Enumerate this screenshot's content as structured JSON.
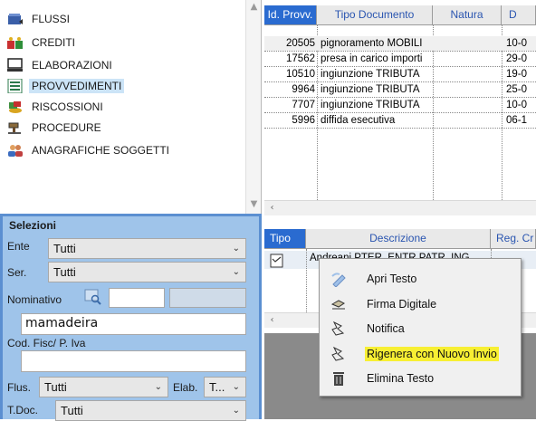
{
  "nav": {
    "items": [
      {
        "label": "FLUSSI",
        "icon": "folder-stack-icon"
      },
      {
        "label": "CREDITI",
        "icon": "money-bags-icon"
      },
      {
        "label": "ELABORAZIONI",
        "icon": "computer-icon"
      },
      {
        "label": "PROVVEDIMENTI",
        "icon": "document-form-icon",
        "selected": true
      },
      {
        "label": "RISCOSSIONI",
        "icon": "coins-icon"
      },
      {
        "label": "PROCEDURE",
        "icon": "gavel-icon"
      },
      {
        "label": "ANAGRAFICHE SOGGETTI",
        "icon": "users-icon"
      }
    ]
  },
  "selezioni": {
    "title": "Selezioni",
    "ente_label": "Ente",
    "ente_value": "Tutti",
    "ser_label": "Ser.",
    "ser_value": "Tutti",
    "nominativo_label": "Nominativo",
    "nominativo_value": "mamadeira",
    "codfisc_label": "Cod. Fisc/ P. Iva",
    "codfisc_value": "",
    "flus_label": "Flus.",
    "flus_value": "Tutti",
    "elab_label": "Elab.",
    "elab_value": "T...",
    "tdoc_label": "T.Doc.",
    "tdoc_value": "Tutti"
  },
  "grid_provv": {
    "columns": [
      "Id. Provv.",
      "Tipo Documento",
      "Natura",
      "D"
    ],
    "rows": [
      {
        "id": "20505",
        "tipo": "pignoramento MOBILI",
        "natura": "",
        "data": "10-0"
      },
      {
        "id": "17562",
        "tipo": "presa in carico importi",
        "natura": "",
        "data": "29-0"
      },
      {
        "id": "10510",
        "tipo": "ingiunzione TRIBUTA",
        "natura": "",
        "data": "19-0"
      },
      {
        "id": "9964",
        "tipo": "ingiunzione TRIBUTA",
        "natura": "",
        "data": "25-0"
      },
      {
        "id": "7707",
        "tipo": "ingiunzione TRIBUTA",
        "natura": "",
        "data": "10-0"
      },
      {
        "id": "5996",
        "tipo": "diffida esecutiva",
        "natura": "",
        "data": "06-1"
      }
    ]
  },
  "grid_doc": {
    "columns": [
      "Tipo",
      "Descrizione",
      "Reg. Cr"
    ],
    "rows": [
      {
        "descrizione": "Andreani PTER, ENTR PATR, ING"
      }
    ]
  },
  "context_menu": {
    "items": [
      {
        "label": "Apri Testo",
        "icon": "open-text-icon"
      },
      {
        "label": "Firma Digitale",
        "icon": "digital-signature-icon"
      },
      {
        "label": "Notifica",
        "icon": "notify-icon"
      },
      {
        "label": "Rigenera con Nuovo Invio",
        "icon": "regenerate-icon",
        "highlighted": true
      },
      {
        "label": "Elimina Testo",
        "icon": "trash-icon"
      }
    ]
  },
  "colors": {
    "selection_panel": "#9fc4ea",
    "selection_border": "#5b8fd1",
    "header_text": "#2a55b0",
    "highlight": "#f7ef33",
    "selected_nav": "#cce4f7"
  }
}
